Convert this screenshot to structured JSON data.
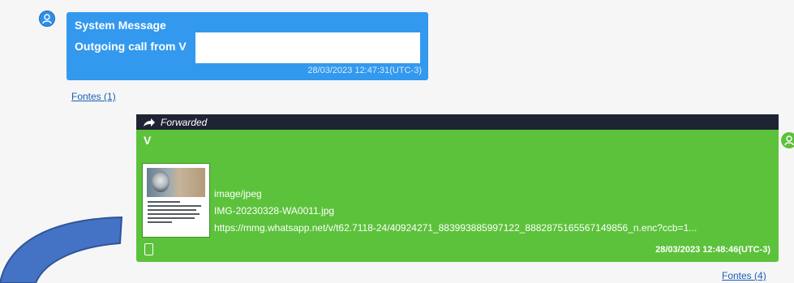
{
  "system_message": {
    "title": "System Message",
    "text": "Outgoing call from V",
    "timestamp": "28/03/2023 12:47:31(UTC-3)",
    "avatar_icon": "user-icon",
    "color": "#3399ee"
  },
  "sources_link_1": "Fontes (1)",
  "forwarded_message": {
    "header_label": "Forwarded",
    "header_icon": "forward-arrow-icon",
    "sender": "V",
    "attachment": {
      "mime_type": "image/jpeg",
      "filename": "IMG-20230328-WA0011.jpg",
      "url": "https://mmg.whatsapp.net/v/t62.7118-24/40924271_883993885997122_8882875165567149856_n.enc?ccb=1..."
    },
    "source_icon": "phone-icon",
    "timestamp": "28/03/2023 12:48:46(UTC-3)",
    "color": "#5cc23b"
  },
  "sources_link_4": "Fontes (4)",
  "annotation": {
    "shape": "curved-arrow",
    "color": "#2f5597"
  }
}
